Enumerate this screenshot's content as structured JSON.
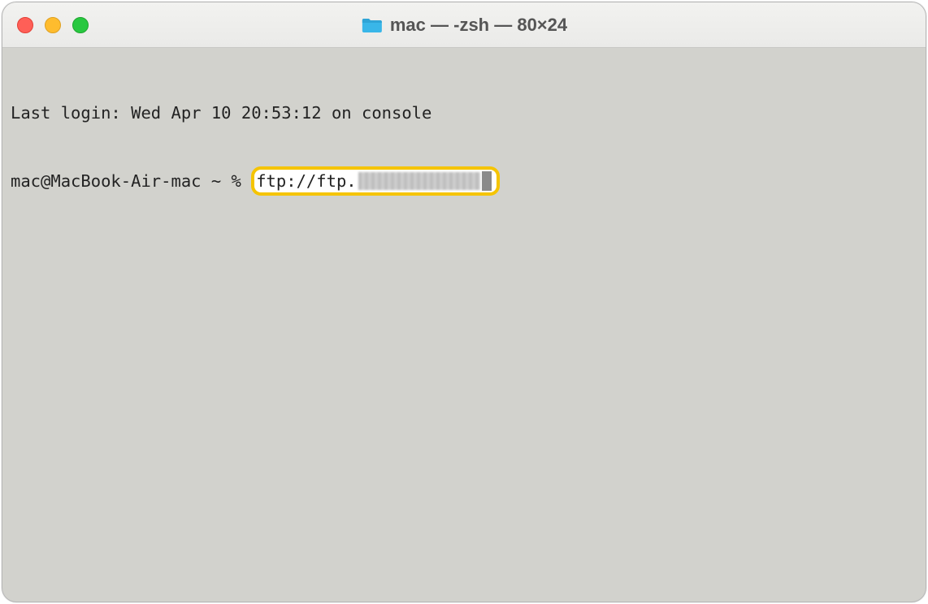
{
  "window": {
    "title": "mac — -zsh — 80×24"
  },
  "terminal": {
    "last_login": "Last login: Wed Apr 10 20:53:12 on console",
    "prompt": "mac@MacBook-Air-mac ~ % ",
    "command_visible": "ftp://ftp.",
    "command_redacted": true
  }
}
